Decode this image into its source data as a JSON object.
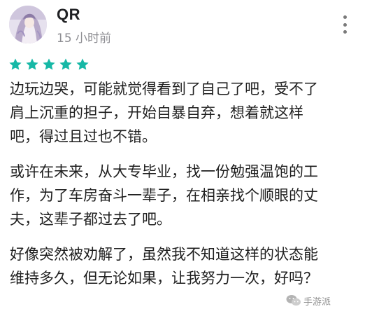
{
  "review": {
    "username": "QR",
    "timestamp": "15 小时前",
    "rating": 5,
    "star_color": "#16b8a6",
    "paragraphs": [
      "边玩边哭，可能就觉得看到了自己了吧，受不了\n肩上沉重的担子，开始自暴自弃，想着就这样\n吧，得过且过也不错。",
      "或许在未来，从大专毕业，找一份勉强温饱的工\n作，为了车房奋斗一辈子，在相亲找个顺眼的丈\n夫，这辈子都过去了吧。",
      "好像突然被劝解了，虽然我不知道这样的状态能\n维持多久，但无论如果，让我努力一次，好吗？"
    ]
  },
  "icons": {
    "avatar": "anime-avatar-image",
    "more": "more-vert-icon",
    "star": "star-icon"
  },
  "watermark": {
    "logo": "wechat-icon",
    "text": "手游派"
  }
}
